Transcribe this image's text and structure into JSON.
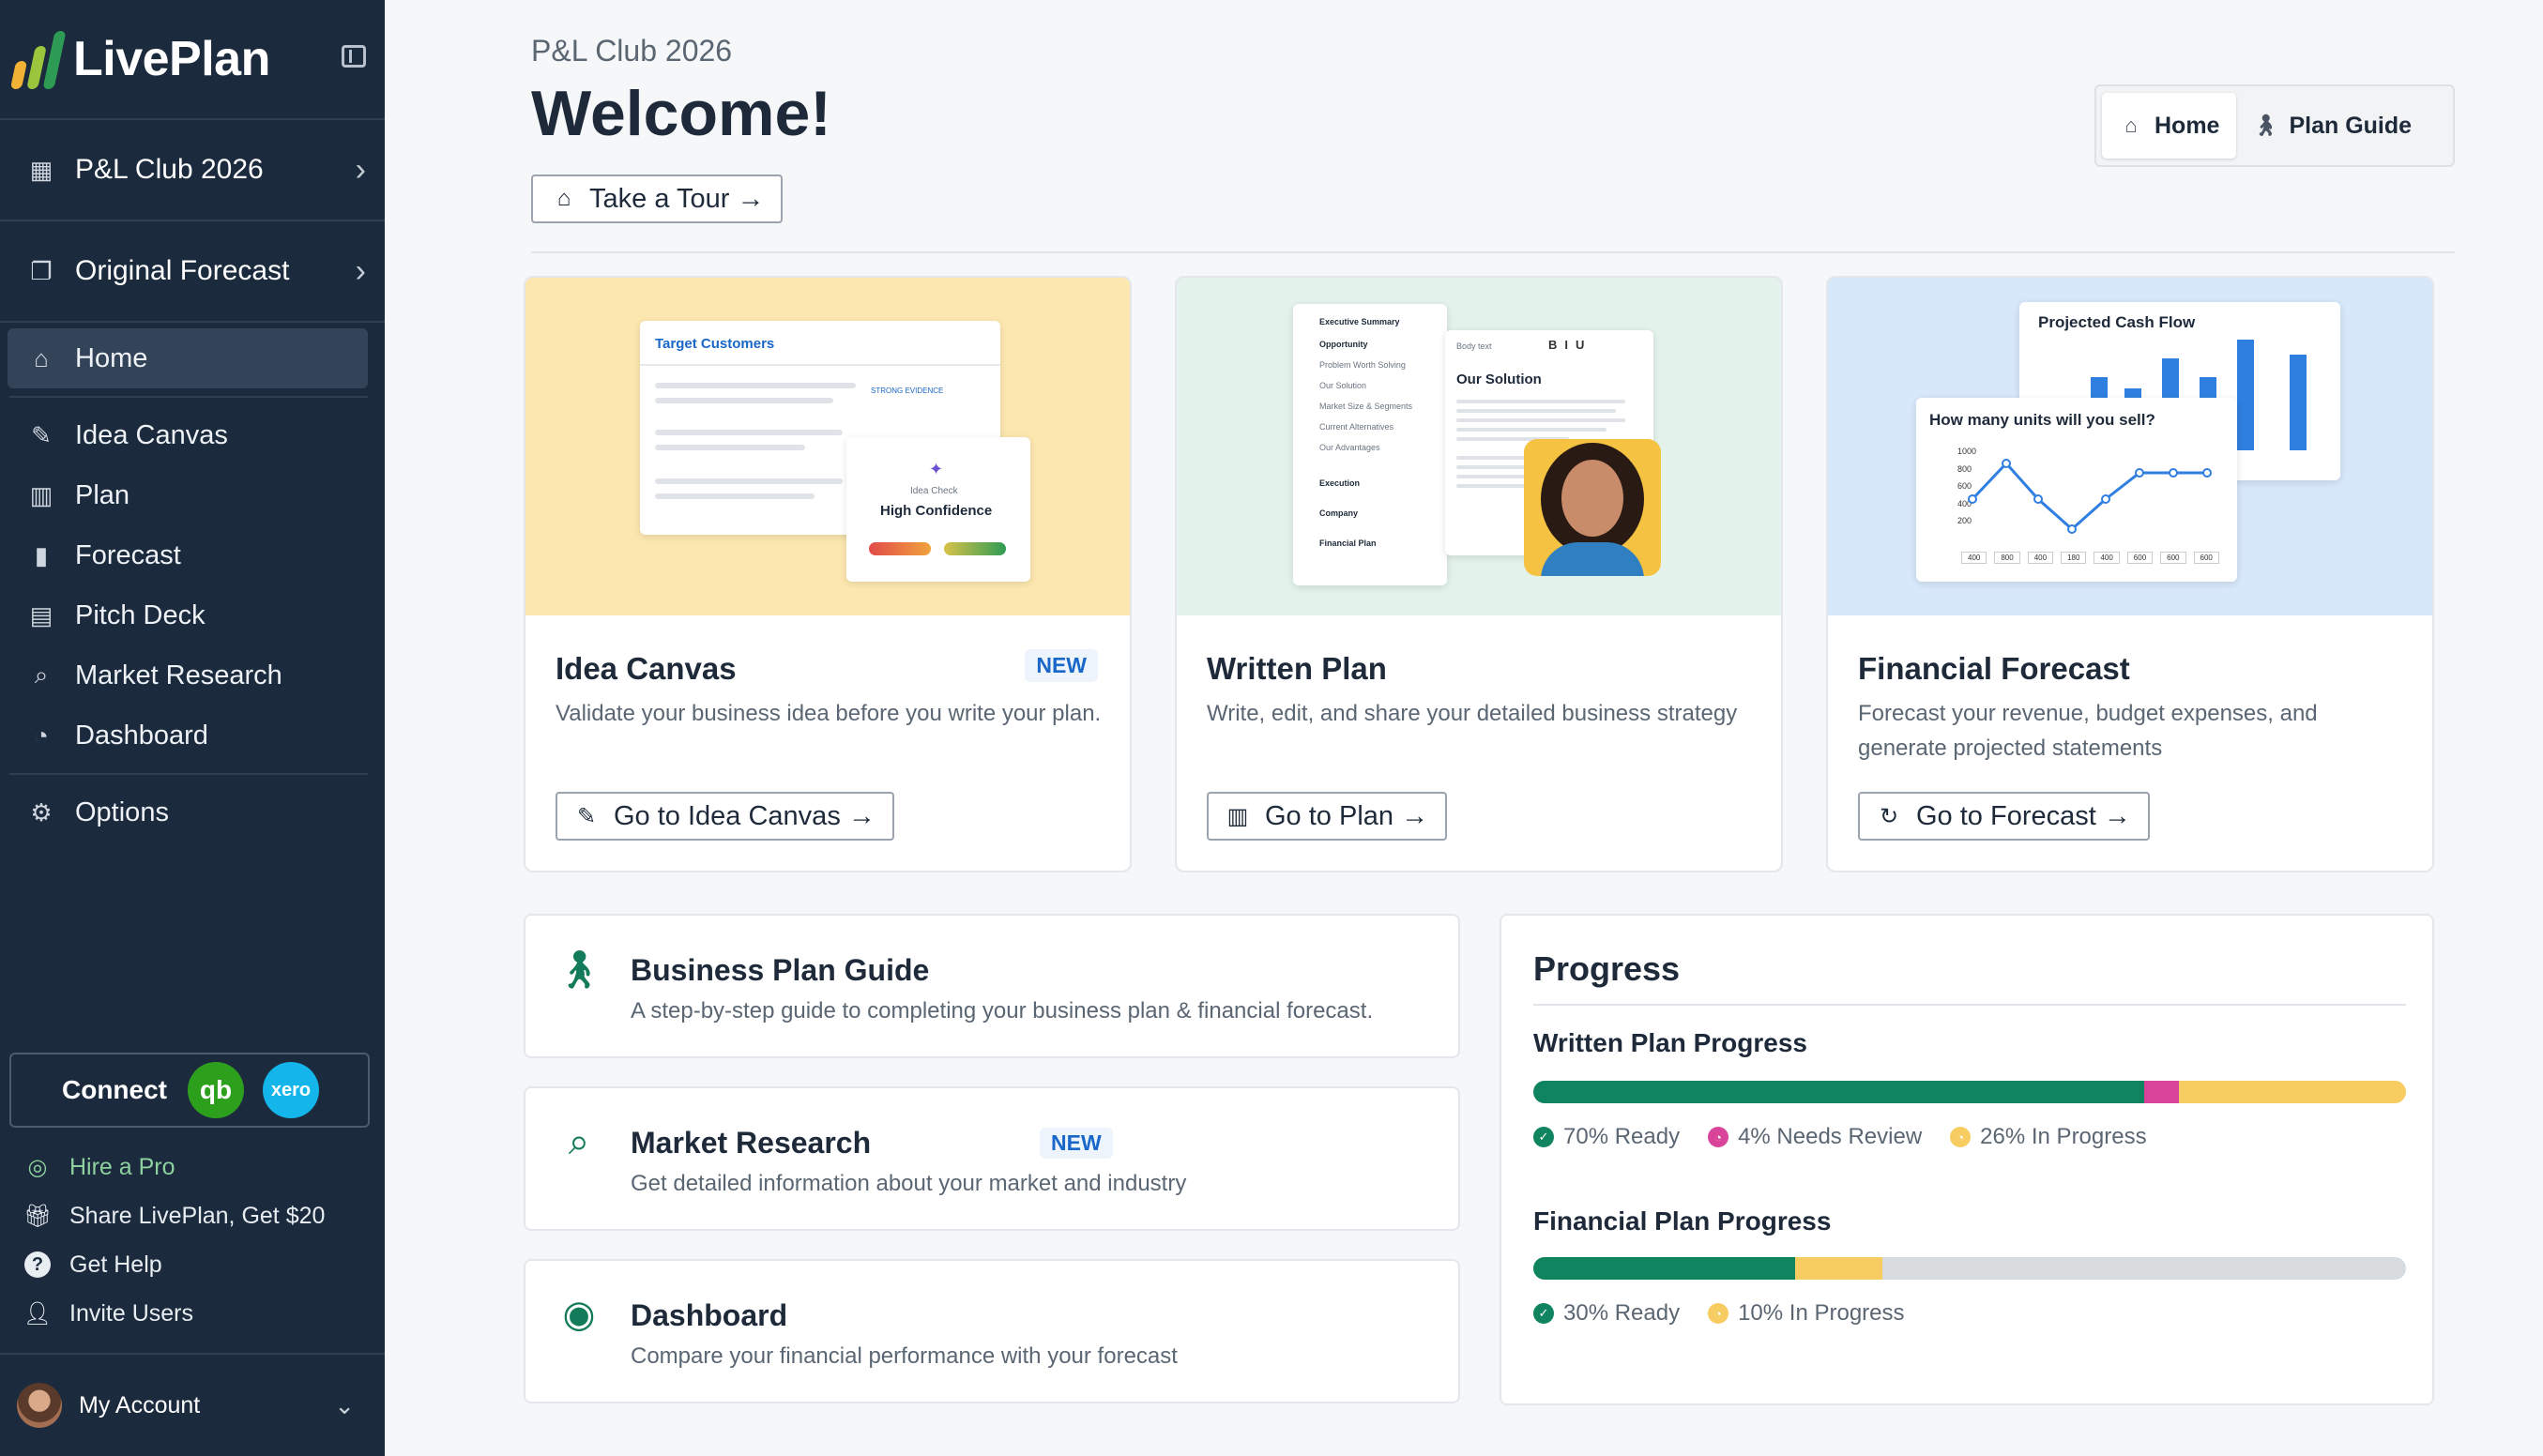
{
  "app": {
    "name": "LivePlan"
  },
  "sidebar": {
    "project": "P&L Club 2026",
    "forecast": "Original Forecast",
    "nav": [
      {
        "label": "Home",
        "icon": "home-icon"
      },
      {
        "label": "Idea Canvas",
        "icon": "pencil-ruler-icon"
      },
      {
        "label": "Plan",
        "icon": "map-icon"
      },
      {
        "label": "Forecast",
        "icon": "bar-chart-icon"
      },
      {
        "label": "Pitch Deck",
        "icon": "slides-icon"
      },
      {
        "label": "Market Research",
        "icon": "search-list-icon"
      },
      {
        "label": "Dashboard",
        "icon": "gauge-icon"
      }
    ],
    "options": "Options",
    "connect": {
      "label": "Connect",
      "qb": "qb",
      "xero": "xero"
    },
    "links": {
      "hire": "Hire a Pro",
      "share": "Share LivePlan, Get $20",
      "help": "Get Help",
      "invite": "Invite Users"
    },
    "account": "My Account"
  },
  "header": {
    "project": "P&L Club 2026",
    "title": "Welcome!",
    "tour_button": "Take a Tour →",
    "tabs": {
      "home": "Home",
      "guide": "Plan Guide"
    }
  },
  "cards": {
    "idea": {
      "title": "Idea Canvas",
      "badge": "NEW",
      "desc": "Validate your business idea before you write your plan.",
      "button": "Go to Idea Canvas →",
      "illus": {
        "sheet_title": "Target Customers",
        "evidence": "STRONG EVIDENCE",
        "check_label": "Idea Check",
        "confidence": "High Confidence"
      }
    },
    "plan": {
      "title": "Written Plan",
      "desc": "Write, edit, and share your detailed business strategy",
      "button": "Go to Plan →",
      "illus": {
        "toc": [
          "Executive Summary",
          "Opportunity",
          "Problem Worth Solving",
          "Our Solution",
          "Market Size & Segments",
          "Current Alternatives",
          "Our Advantages",
          "Execution",
          "Company",
          "Financial Plan"
        ],
        "toolbar": "Body text",
        "heading": "Our Solution"
      }
    },
    "forecast": {
      "title": "Financial Forecast",
      "desc": "Forecast your revenue, budget expenses, and generate projected statements",
      "button": "Go to Forecast →",
      "illus": {
        "cash_title": "Projected Cash Flow",
        "units_title": "How many units will you sell?",
        "y_ticks": [
          "1000",
          "800",
          "600",
          "400",
          "200"
        ],
        "x_ticks": [
          "400",
          "800",
          "400",
          "180",
          "400",
          "600",
          "600",
          "600"
        ]
      }
    }
  },
  "guides": [
    {
      "title": "Business Plan Guide",
      "desc": "A step-by-step guide to completing your business plan & financial forecast."
    },
    {
      "title": "Market Research",
      "badge": "NEW",
      "desc": "Get detailed information about your market and industry"
    },
    {
      "title": "Dashboard",
      "desc": "Compare your financial performance with your forecast"
    }
  ],
  "progress": {
    "title": "Progress",
    "written": {
      "label": "Written Plan Progress",
      "ready": 70,
      "review": 4,
      "inprogress": 26,
      "legend": [
        "70% Ready",
        "4% Needs Review",
        "26% In Progress"
      ]
    },
    "financial": {
      "label": "Financial Plan Progress",
      "ready": 30,
      "inprogress": 10,
      "legend": [
        "30% Ready",
        "10% In Progress"
      ]
    },
    "colors": {
      "ready": "#10845e",
      "review": "#d9449a",
      "inprogress": "#f7cd62",
      "remaining": "#d9dcdf"
    }
  }
}
